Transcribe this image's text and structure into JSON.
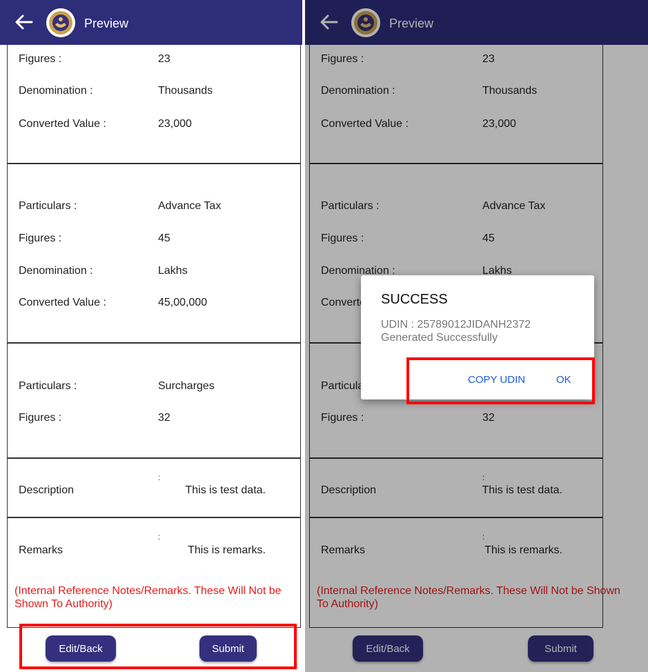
{
  "appbar": {
    "title": "Preview"
  },
  "sections": {
    "figures_label": "Figures :",
    "denomination_label": "Denomination :",
    "converted_label": "Converted Value :",
    "particulars_label": "Particulars :",
    "description_label": "Description",
    "remarks_label": "Remarks",
    "colon": ":"
  },
  "entry1": {
    "figures": "23",
    "denomination": "Thousands",
    "converted": "23,000"
  },
  "entry2": {
    "particulars": "Advance Tax",
    "figures": "45",
    "denomination": "Lakhs",
    "converted": "45,00,000"
  },
  "entry3": {
    "particulars": "Surcharges",
    "figures": "32"
  },
  "description": "This is test data.",
  "remarks": "This is remarks.",
  "note": "(Internal Reference Notes/Remarks. These Will Not be Shown To Authority)",
  "buttons": {
    "edit_back": "Edit/Back",
    "submit": "Submit"
  },
  "dialog": {
    "title": "SUCCESS",
    "message": "UDIN : 25789012JIDANH2372 Generated Successfully",
    "copy_button": "COPY UDIN",
    "ok_button": "OK"
  },
  "colors": {
    "appbar": "#2d2d7a",
    "button": "#34307d",
    "note_red": "#e31b1b",
    "highlight_red": "#ff0000",
    "dialog_action": "#1e5ad6"
  }
}
